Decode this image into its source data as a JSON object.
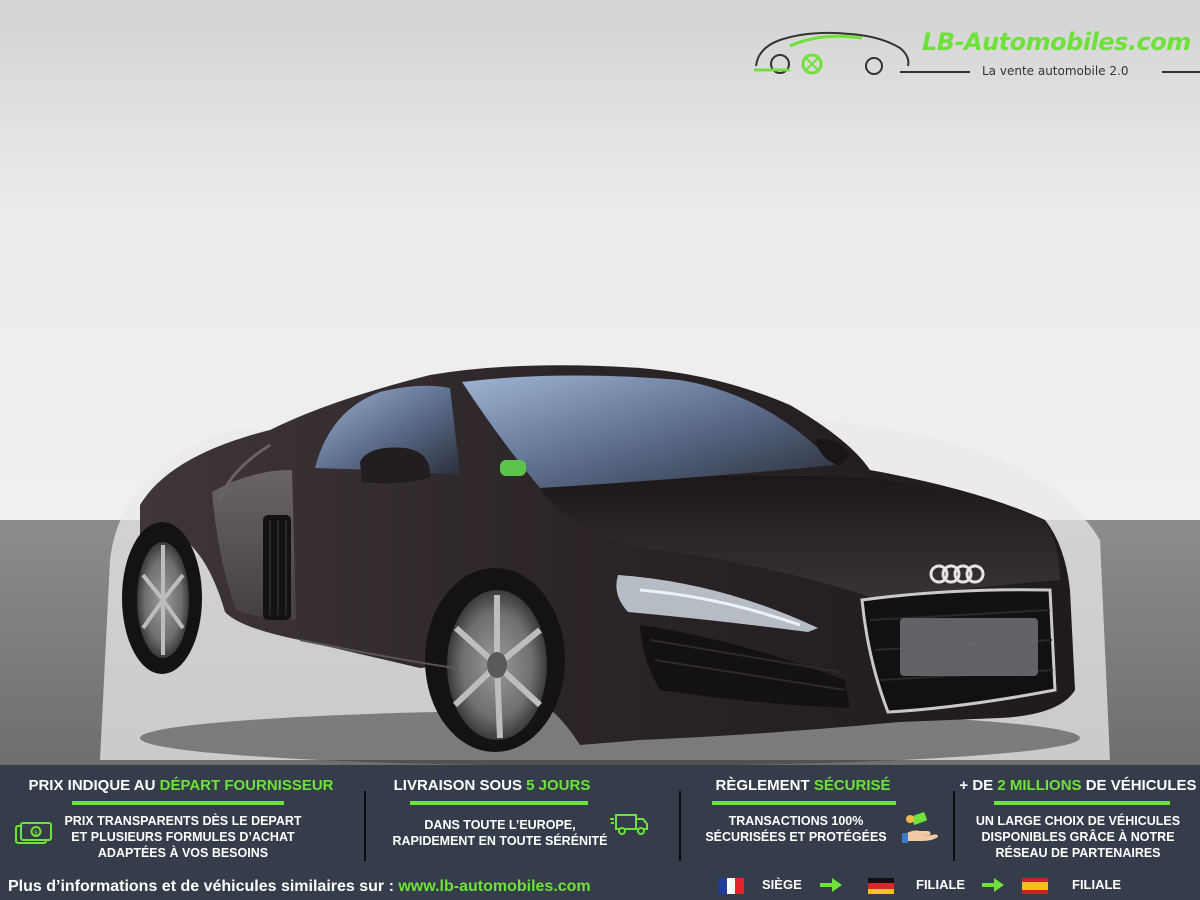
{
  "logo": {
    "brand": "LB-Automobiles.com",
    "tagline": "La vente automobile 2.0",
    "icon": "sports-car-logo-icon"
  },
  "banner": {
    "columns": [
      {
        "title_pre": "PRIX INDIQUE AU ",
        "title_accent": "DÉPART FOURNISSEUR",
        "title_post": "",
        "body": [
          "PRIX TRANSPARENTS DÈS LE DEPART",
          "ET PLUSIEURS FORMULES D’ACHAT",
          "ADAPTÉES À VOS BESOINS"
        ],
        "icon": "money-bill-icon"
      },
      {
        "title_pre": "LIVRAISON SOUS ",
        "title_accent": "5 JOURS",
        "title_post": "",
        "body": [
          "DANS TOUTE L’EUROPE,",
          "RAPIDEMENT EN TOUTE SÉRÉNITÉ"
        ],
        "icon": "delivery-truck-icon"
      },
      {
        "title_pre": "RÈGLEMENT ",
        "title_accent": "SÉCURISÉ",
        "title_post": "",
        "body": [
          "TRANSACTIONS 100%",
          "SÉCURISÉES ET PROTÉGÉES"
        ],
        "icon": "payment-hand-icon"
      },
      {
        "title_pre": "+ DE ",
        "title_accent": "2 MILLIONS",
        "title_post": " DE VÉHICULES",
        "body": [
          "UN LARGE CHOIX DE VÉHICULES",
          "DISPONIBLES GRÂCE À NOTRE",
          "RÉSEAU DE PARTENAIRES"
        ]
      }
    ],
    "footer": {
      "text": "Plus d’informations et de véhicules similaires sur : ",
      "url": "www.lb-automobiles.com"
    },
    "locations": [
      {
        "flag": "france-flag-icon",
        "label": "SIÈGE"
      },
      {
        "flag": "germany-flag-icon",
        "label": "FILIALE"
      },
      {
        "flag": "spain-flag-icon",
        "label": "FILIALE"
      }
    ]
  },
  "colors": {
    "accent_green": "#6ee23a",
    "banner_bg": "#353d4a",
    "car_body": "#2f292d"
  }
}
